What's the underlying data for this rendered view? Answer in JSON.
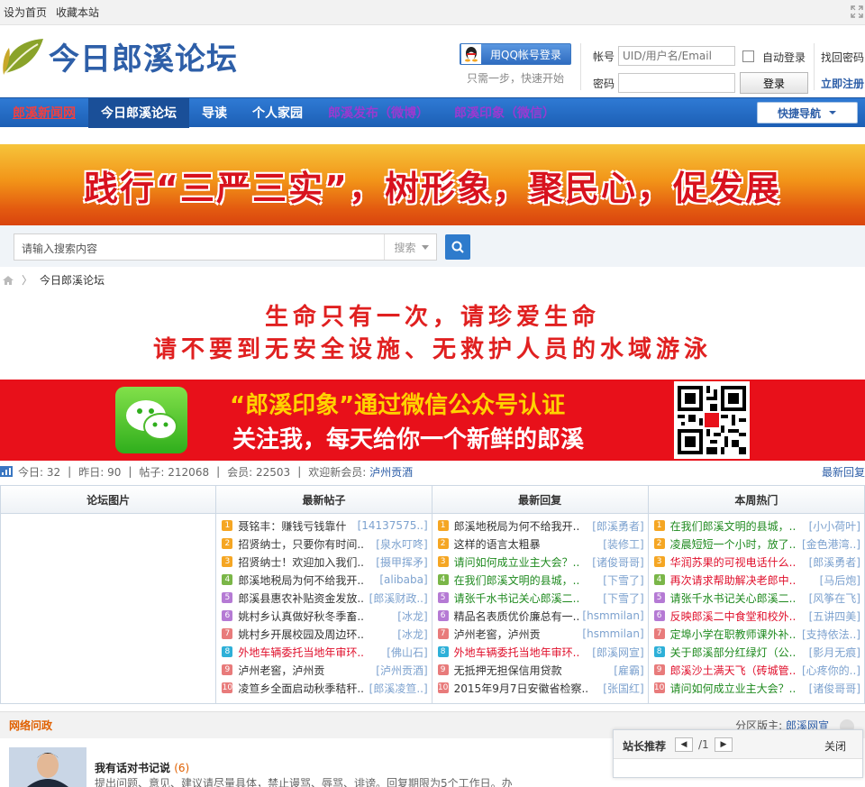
{
  "topbar": {
    "set_home": "设为首页",
    "bookmark": "收藏本站"
  },
  "logo": {
    "text": "今日郎溪论坛"
  },
  "login": {
    "qq_button": "用QQ帐号登录",
    "qq_tip": "只需一步，快速开始",
    "account_label": "帐号",
    "password_label": "密码",
    "account_placeholder": "UID/用户名/Email",
    "auto_login": "自动登录",
    "login_button": "登录",
    "find_password": "找回密码",
    "register": "立即注册"
  },
  "nav": {
    "items": [
      "郎溪新闻网",
      "今日郎溪论坛",
      "导读",
      "个人家园",
      "郎溪发布（微博）",
      "郎溪印象（微信）"
    ],
    "quick": "快捷导航"
  },
  "banner": {
    "text": "践行“三严三实”，树形象，聚民心，促发展"
  },
  "search": {
    "placeholder": "请输入搜索内容",
    "type": "搜索"
  },
  "breadcrumb": {
    "current": "今日郎溪论坛"
  },
  "notice": {
    "line1": "生命只有一次，请珍爱生命",
    "line2": "请不要到无安全设施、无救护人员的水域游泳"
  },
  "wechat": {
    "line1": "“郎溪印象”通过微信公众号认证",
    "line2": "关注我，每天给你一个新鲜的郎溪"
  },
  "stats": {
    "today_label": "今日:",
    "today": "32",
    "yesterday_label": "昨日:",
    "yesterday": "90",
    "posts_label": "帖子:",
    "posts": "212068",
    "members_label": "会员:",
    "members": "22503",
    "welcome_label": "欢迎新会员:",
    "new_member": "泸州贡酒",
    "latest_reply": "最新回复"
  },
  "columns": {
    "pics": "论坛图片",
    "new_posts": "最新帖子",
    "new_replies": "最新回复",
    "hot": "本周热门"
  },
  "colors": {
    "num": [
      "#f5a623",
      "#f5a623",
      "#f5a623",
      "#7ab648",
      "#b57ad4",
      "#b57ad4",
      "#e87b7b",
      "#2eb0d8",
      "#e87b7b",
      "#e87b7b"
    ]
  },
  "new_posts": [
    {
      "n": "1",
      "t": "聂铭丰：赚钱亏钱靠什",
      "a": "[14137575..]",
      "c": ""
    },
    {
      "n": "2",
      "t": "招贤纳士，只要你有时间..",
      "a": "[泉水叮咚]",
      "c": ""
    },
    {
      "n": "3",
      "t": "招贤纳士！欢迎加入我们..",
      "a": "[摄甲挥矛]",
      "c": ""
    },
    {
      "n": "4",
      "t": "郎溪地税局为何不给我开..",
      "a": "[alibaba]",
      "c": ""
    },
    {
      "n": "5",
      "t": "郎溪县惠农补贴资金发放..",
      "a": "[郎溪财政..]",
      "c": ""
    },
    {
      "n": "6",
      "t": "姚村乡认真做好秋冬季畜..",
      "a": "[冰龙]",
      "c": ""
    },
    {
      "n": "7",
      "t": "姚村乡开展校园及周边环..",
      "a": "[冰龙]",
      "c": ""
    },
    {
      "n": "8",
      "t": "外地车辆委托当地年审环..",
      "a": "[佛山石]",
      "c": "red"
    },
    {
      "n": "9",
      "t": "泸州老窖，泸州贡",
      "a": "[泸州贡酒]",
      "c": ""
    },
    {
      "n": "10",
      "t": "凌笪乡全面启动秋季秸秆..",
      "a": "[郎溪凌笪..]",
      "c": ""
    }
  ],
  "new_replies": [
    {
      "n": "1",
      "t": "郎溪地税局为何不给我开..",
      "a": "[郎溪勇者]",
      "c": ""
    },
    {
      "n": "2",
      "t": "这样的语言太粗暴",
      "a": "[装修工]",
      "c": ""
    },
    {
      "n": "3",
      "t": "请问如何成立业主大会？..",
      "a": "[诸俊哥哥]",
      "c": "green"
    },
    {
      "n": "4",
      "t": "在我们郎溪文明的县城，..",
      "a": "[下雪了]",
      "c": "green"
    },
    {
      "n": "5",
      "t": "请张千水书记关心郎溪二..",
      "a": "[下雪了]",
      "c": "green"
    },
    {
      "n": "6",
      "t": "精品名表质优价廉总有一..",
      "a": "[hsmmilan]",
      "c": ""
    },
    {
      "n": "7",
      "t": "泸州老窖，泸州贡",
      "a": "[hsmmilan]",
      "c": ""
    },
    {
      "n": "8",
      "t": "外地车辆委托当地年审环..",
      "a": "[郎溪网宣]",
      "c": "red"
    },
    {
      "n": "9",
      "t": "无抵押无担保信用贷款",
      "a": "[雇霸]",
      "c": ""
    },
    {
      "n": "10",
      "t": "2015年9月7日安徽省检察..",
      "a": "[张国红]",
      "c": ""
    }
  ],
  "hot": [
    {
      "n": "1",
      "t": "在我们郎溪文明的县城，..",
      "a": "[小小荷叶]",
      "c": "green"
    },
    {
      "n": "2",
      "t": "凌晨短短一个小时，放了..",
      "a": "[金色港湾..]",
      "c": "green"
    },
    {
      "n": "3",
      "t": "华润苏果的可视电话什么..",
      "a": "[郎溪勇者]",
      "c": "red"
    },
    {
      "n": "4",
      "t": "再次请求帮助解决老郎中..",
      "a": "[马后炮]",
      "c": "red"
    },
    {
      "n": "5",
      "t": "请张千水书记关心郎溪二..",
      "a": "[风筝在飞]",
      "c": "green"
    },
    {
      "n": "6",
      "t": "反映郎溪二中食堂和校外..",
      "a": "[五讲四美]",
      "c": "red"
    },
    {
      "n": "7",
      "t": "定埠小学在职教师课外补..",
      "a": "[支持依法..]",
      "c": "green"
    },
    {
      "n": "8",
      "t": "关于郎溪部分红绿灯（公..",
      "a": "[影月无痕]",
      "c": "green"
    },
    {
      "n": "9",
      "t": "郎溪沙土满天飞（砖城管..",
      "a": "[心疼你的..]",
      "c": "red"
    },
    {
      "n": "10",
      "t": "请问如何成立业主大会？..",
      "a": "[诸俊哥哥]",
      "c": "green"
    }
  ],
  "subforum": {
    "title": "网络问政",
    "mod_label": "分区版主:",
    "mod": "郎溪网宣",
    "thread_title": "我有话对书记说",
    "thread_count": "(6)",
    "thread_desc": "提出问题、意见、建议请尽量具体，禁止谩骂、辱骂、诽谤。回复期限为5个工作日。办"
  },
  "popup": {
    "title": "站长推荐",
    "pager": "/1",
    "close": "关闭"
  }
}
